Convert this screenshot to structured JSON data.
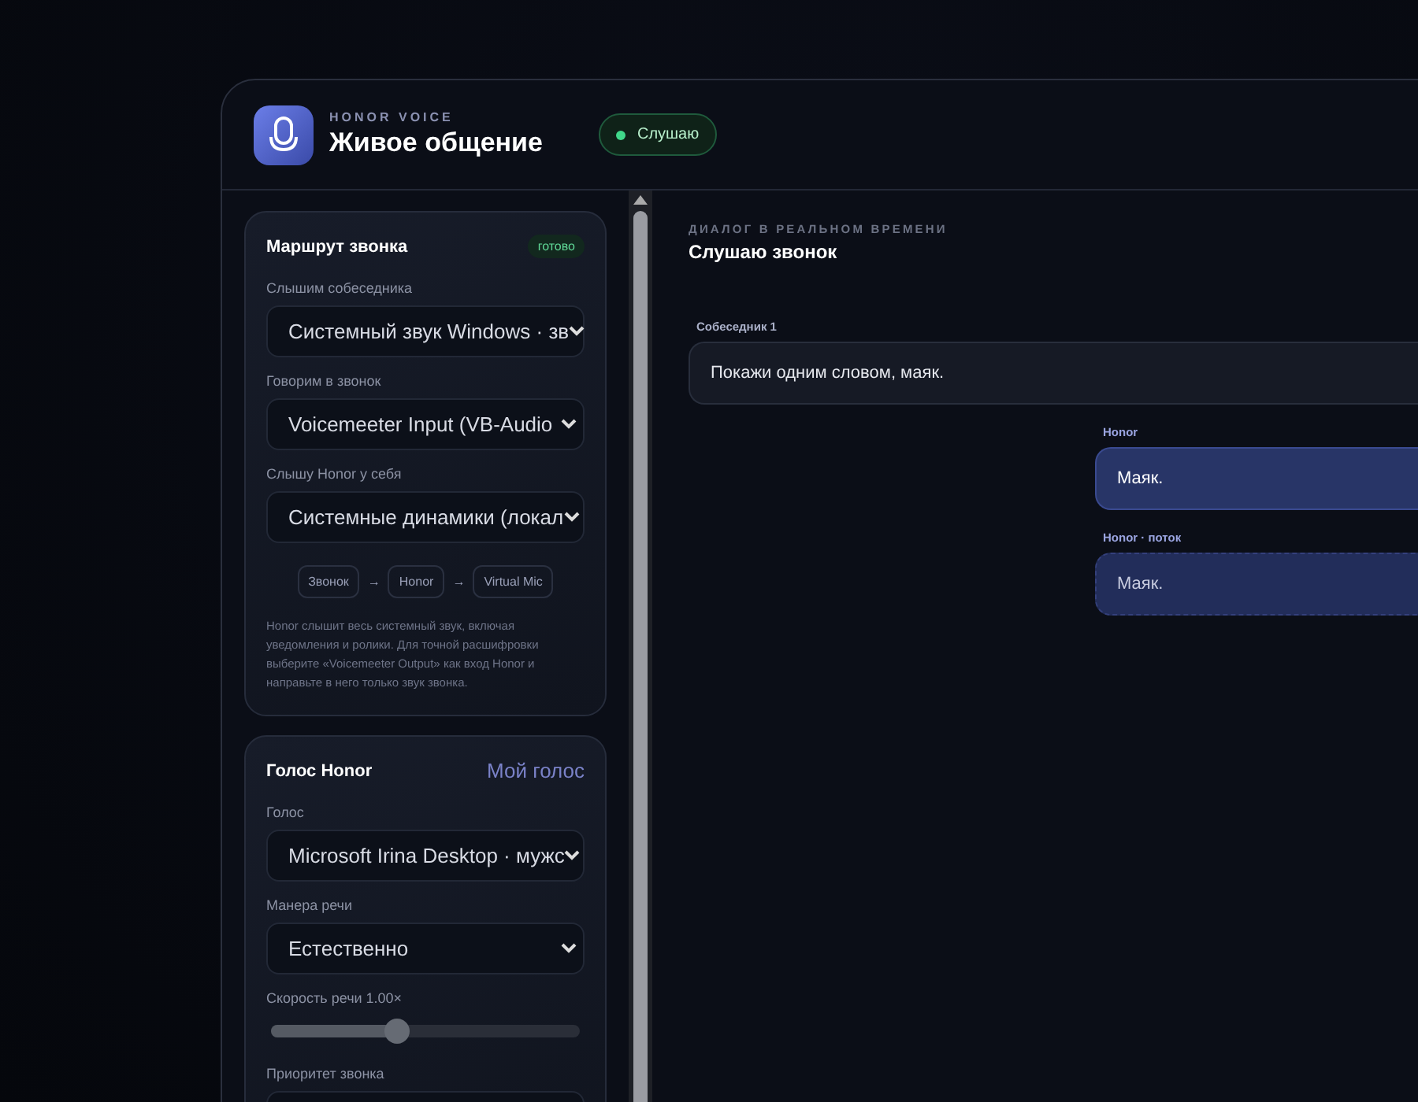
{
  "header": {
    "brand": "HONOR VOICE",
    "title": "Живое общение",
    "status": {
      "label": "Слушаю",
      "on": true
    }
  },
  "route_card": {
    "title": "Маршрут звонка",
    "badge": "готово",
    "fields": [
      {
        "label": "Слышим собеседника",
        "value": "Системный звук Windows · зв"
      },
      {
        "label": "Говорим в звонок",
        "value": "Voicemeeter Input (VB-Audio"
      },
      {
        "label": "Слышу Honor у себя",
        "value": "Системные динамики (локал"
      }
    ],
    "flow": [
      "Звонок",
      "→",
      "Honor",
      "→",
      "Virtual Mic"
    ],
    "note": "Honor слышит весь системный звук, включая уведомления и ролики. Для точной расшифровки выберите «Voicemeeter Output» как вход Honor и направьте в него только звук звонка."
  },
  "voice_card": {
    "title": "Голос Honor",
    "link": "Мой голос",
    "fields": [
      {
        "kind": "select",
        "label": "Голос",
        "value": "Microsoft Irina Desktop · мужс"
      },
      {
        "kind": "select",
        "label": "Манера речи",
        "value": "Естественно"
      },
      {
        "kind": "slider",
        "label": "Скорость речи 1.00×",
        "level": 0.41
      },
      {
        "kind": "select",
        "label": "Приоритет звонка"
      }
    ]
  },
  "dialog": {
    "eyebrow": "ДИАЛОГ В РЕАЛЬНОМ ВРЕМЕНИ",
    "title": "Слушаю звонок",
    "messages": [
      {
        "kind": "peer",
        "author": "Собеседник 1",
        "text": "Покажи одним словом, маяк."
      },
      {
        "kind": "honor",
        "author": "Honor",
        "text": "Маяк."
      },
      {
        "kind": "stream",
        "author": "Honor · поток",
        "text": "Маяк."
      }
    ]
  }
}
